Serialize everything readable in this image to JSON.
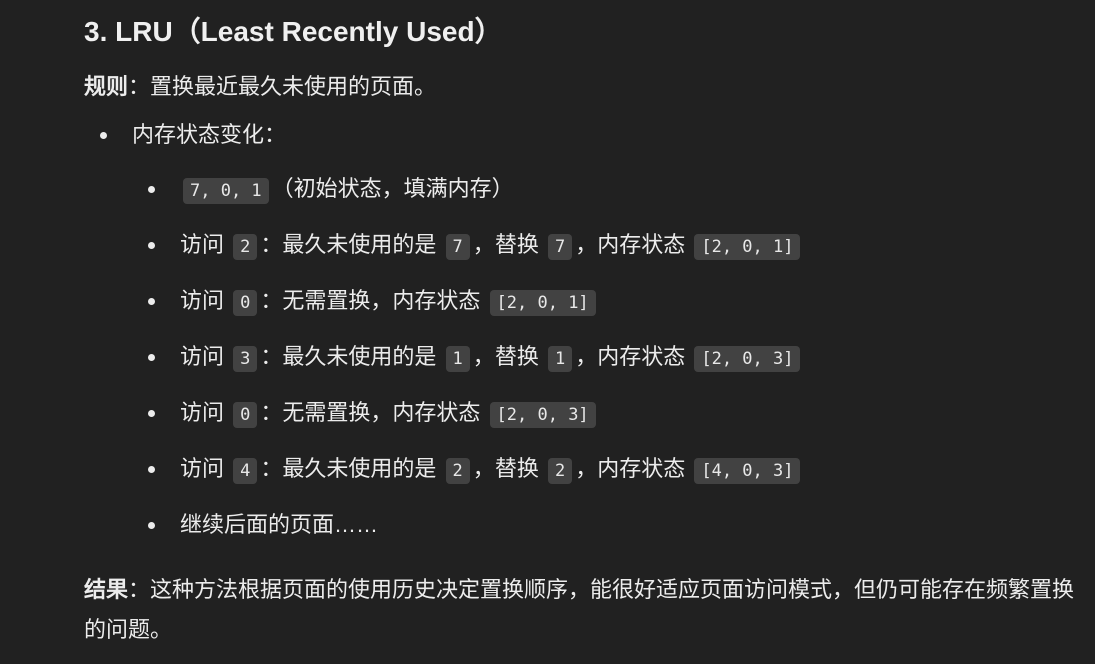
{
  "heading": "3. LRU（Least Recently Used）",
  "rule": {
    "label": "规则",
    "colon": "：",
    "text": "置换最近最久未使用的页面。"
  },
  "memory": {
    "label": "内存状态变化：",
    "initial": {
      "code": "7, 0, 1",
      "note": "（初始状态，填满内存）"
    },
    "visit_word": "访问",
    "colon": "：",
    "lru_phrase": "最久未使用的是",
    "comma": "，",
    "replace_word": "替换",
    "state_word": "内存状态",
    "no_replace": "无需置换，内存状态",
    "steps": [
      {
        "page": "2",
        "victim": "7",
        "state": "[2, 0, 1]"
      },
      {
        "page": "0",
        "state": "[2, 0, 1]"
      },
      {
        "page": "3",
        "victim": "1",
        "state": "[2, 0, 3]"
      },
      {
        "page": "0",
        "state": "[2, 0, 3]"
      },
      {
        "page": "4",
        "victim": "2",
        "state": "[4, 0, 3]"
      }
    ],
    "continue_text": "继续后面的页面……"
  },
  "result": {
    "label": "结果",
    "colon": "：",
    "text": "这种方法根据页面的使用历史决定置换顺序，能很好适应页面访问模式，但仍可能存在频繁置换的问题。"
  }
}
